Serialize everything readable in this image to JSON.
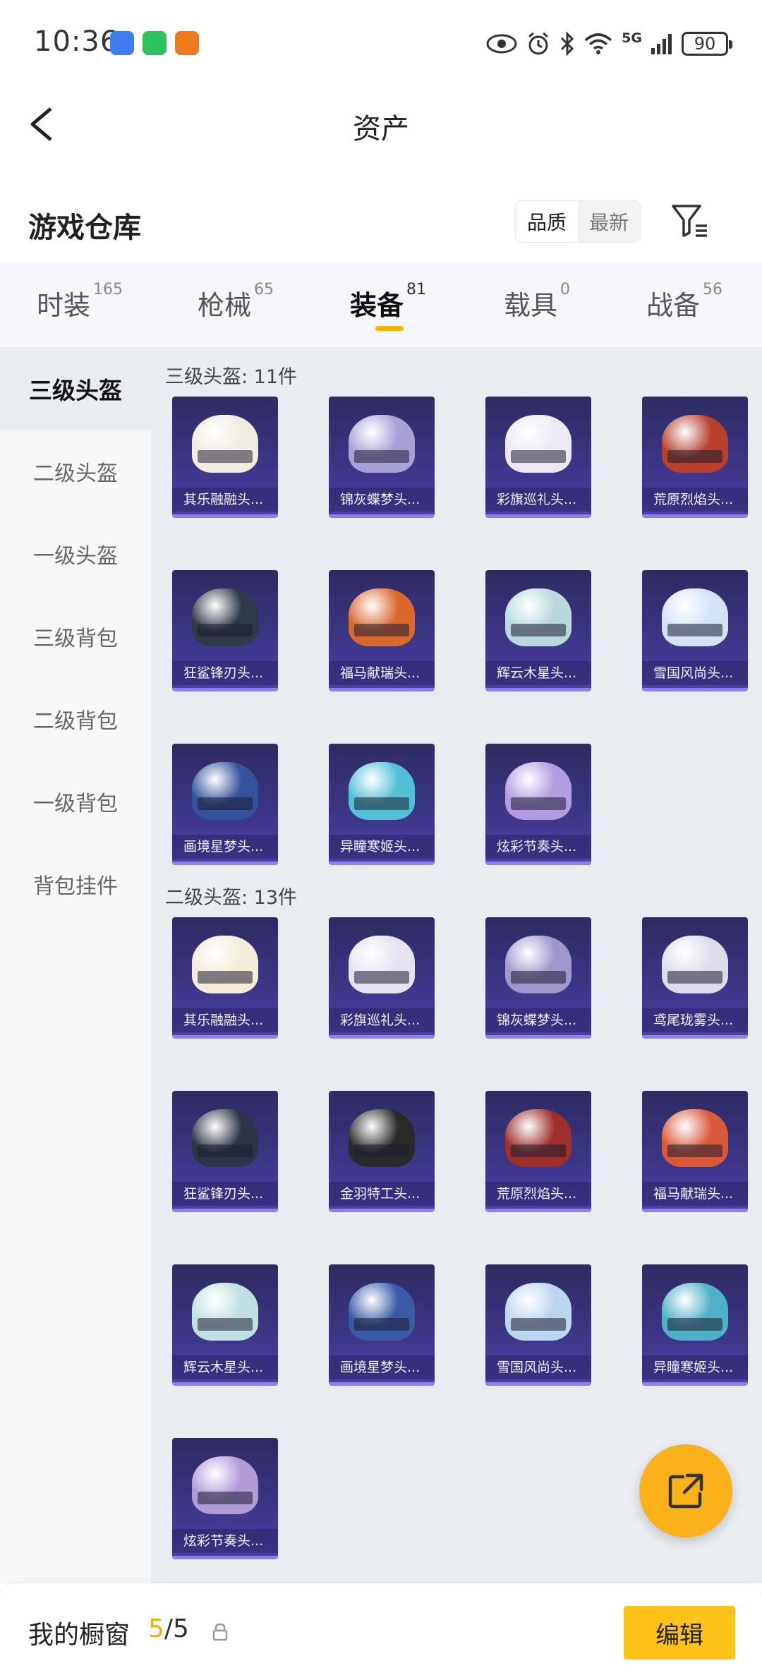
{
  "status_bar": {
    "time": "10:36",
    "network": "5G",
    "battery": "90",
    "icons": [
      "eye-icon",
      "alarm-icon",
      "bluetooth-icon",
      "wifi-icon",
      "signal-icon"
    ]
  },
  "header": {
    "title": "资产",
    "back_icon": "back-chevron-icon"
  },
  "warehouse": {
    "title": "游戏仓库",
    "sort_options": [
      "品质",
      "最新"
    ],
    "sort_active": "品质",
    "filter_icon": "filter-icon"
  },
  "tabs": [
    {
      "label": "时装",
      "count": "165"
    },
    {
      "label": "枪械",
      "count": "65"
    },
    {
      "label": "装备",
      "count": "81",
      "active": true
    },
    {
      "label": "载具",
      "count": "0"
    },
    {
      "label": "战备",
      "count": "56"
    }
  ],
  "sidebar": [
    {
      "label": "三级头盔",
      "active": true
    },
    {
      "label": "二级头盔"
    },
    {
      "label": "一级头盔"
    },
    {
      "label": "三级背包"
    },
    {
      "label": "二级背包"
    },
    {
      "label": "一级背包"
    },
    {
      "label": "背包挂件"
    }
  ],
  "groups": [
    {
      "title": "三级头盔: 11件",
      "items": [
        {
          "name": "其乐融融头...",
          "color": "#f1ece2"
        },
        {
          "name": "锦灰蝶梦头...",
          "color": "#a9a0d6"
        },
        {
          "name": "彩旗巡礼头...",
          "color": "#ece8f6"
        },
        {
          "name": "荒原烈焰头...",
          "color": "#b8402a"
        },
        {
          "name": "狂鲨锋刃头...",
          "color": "#30394a"
        },
        {
          "name": "福马献瑞头...",
          "color": "#d9682f"
        },
        {
          "name": "辉云木星头...",
          "color": "#b8d8de"
        },
        {
          "name": "雪国风尚头...",
          "color": "#d4e2f6"
        },
        {
          "name": "画境星梦头...",
          "color": "#33549c"
        },
        {
          "name": "异瞳寒姬头...",
          "color": "#52c0d6"
        },
        {
          "name": "炫彩节奏头...",
          "color": "#b39be0"
        }
      ]
    },
    {
      "title": "二级头盔: 13件",
      "items": [
        {
          "name": "其乐融融头...",
          "color": "#f4ecd8"
        },
        {
          "name": "彩旗巡礼头...",
          "color": "#e6e2f2"
        },
        {
          "name": "锦灰蝶梦头...",
          "color": "#9f97cc"
        },
        {
          "name": "鸢尾珑雾头...",
          "color": "#dcdcec"
        },
        {
          "name": "狂鲨锋刃头...",
          "color": "#2c3446"
        },
        {
          "name": "金羽特工头...",
          "color": "#2a2a2a"
        },
        {
          "name": "荒原烈焰头...",
          "color": "#9e2f2b"
        },
        {
          "name": "福马献瑞头...",
          "color": "#d95a3a"
        },
        {
          "name": "辉云木星头...",
          "color": "#bfe0e0"
        },
        {
          "name": "画境星梦头...",
          "color": "#3a5aa6"
        },
        {
          "name": "雪国风尚头...",
          "color": "#bcd6f0"
        },
        {
          "name": "异瞳寒姬头...",
          "color": "#4fb0c8"
        },
        {
          "name": "炫彩节奏头...",
          "color": "#b09ad8"
        }
      ]
    }
  ],
  "fab_icon": "share-external-icon",
  "bottom": {
    "label": "我的橱窗",
    "used": "5",
    "separator": "/",
    "total": "5",
    "lock_icon": "lock-icon",
    "edit_label": "编辑"
  }
}
